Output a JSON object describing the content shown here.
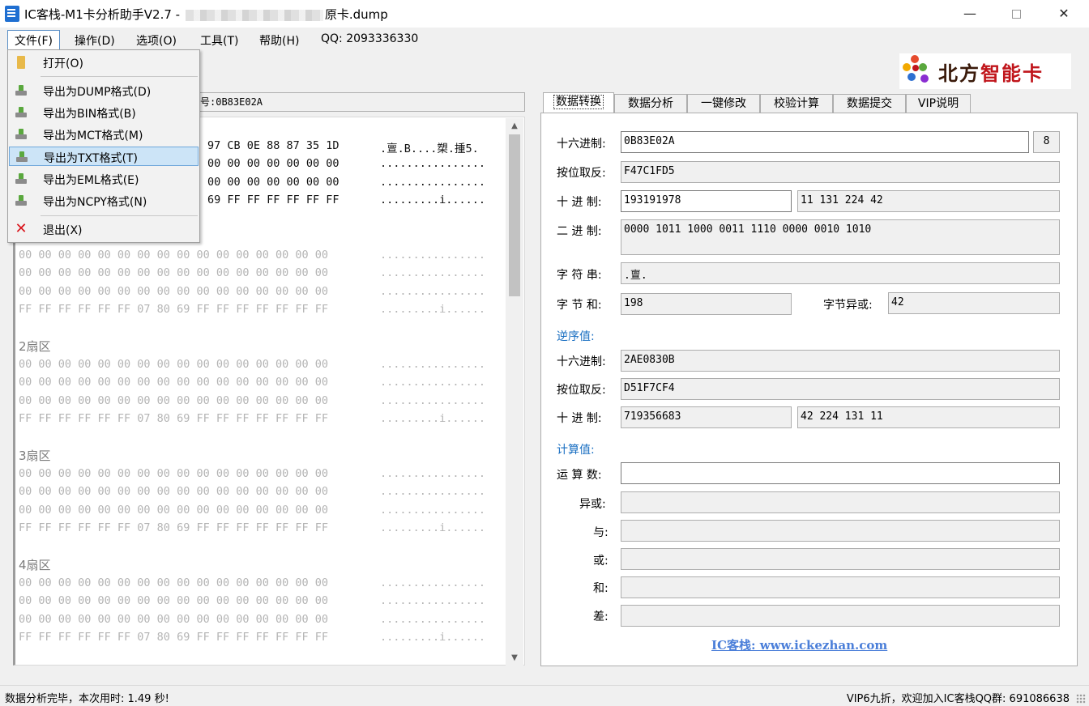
{
  "window": {
    "title_prefix": "IC客栈-M1卡分析助手V2.7 -",
    "title_suffix": "原卡.dump",
    "min": "—",
    "close": "✕"
  },
  "menubar": {
    "file": "文件(F)",
    "operate": "操作(D)",
    "options": "选项(O)",
    "tools": "工具(T)",
    "help": "帮助(H)",
    "qq": "QQ: 2093336330"
  },
  "logo": {
    "text_a": "北方",
    "text_b": "智能卡"
  },
  "file_menu": {
    "open": "打开(O)",
    "dump": "导出为DUMP格式(D)",
    "bin": "导出为BIN格式(B)",
    "mct": "导出为MCT格式(M)",
    "txt": "导出为TXT格式(T)",
    "eml": "导出为EML格式(E)",
    "ncpy": "导出为NCPY格式(N)",
    "exit": "退出(X)"
  },
  "left": {
    "card_no": "卡号:0B83E02A",
    "sector0": [
      {
        "hex": "97 CB 0E 88 87 35 1D",
        "ascii": ".亶.B....槊.揰5."
      },
      {
        "hex": "00 00 00 00 00 00 00",
        "ascii": "................"
      },
      {
        "hex": "00 00 00 00 00 00 00",
        "ascii": "................"
      },
      {
        "hex": "69 FF FF FF FF FF FF",
        "ascii": ".........i......"
      }
    ],
    "sectors": [
      {
        "title": "",
        "rows": [
          {
            "hex": "00 00 00 00 00 00 00 00 00 00 00 00 00 00 00 00",
            "ascii": "................"
          },
          {
            "hex": "00 00 00 00 00 00 00 00 00 00 00 00 00 00 00 00",
            "ascii": "................"
          },
          {
            "hex": "00 00 00 00 00 00 00 00 00 00 00 00 00 00 00 00",
            "ascii": "................"
          },
          {
            "hex": "FF FF FF FF FF FF 07 80 69 FF FF FF FF FF FF FF",
            "ascii": ".........i......"
          }
        ]
      },
      {
        "title": "2扇区",
        "rows": [
          {
            "hex": "00 00 00 00 00 00 00 00 00 00 00 00 00 00 00 00",
            "ascii": "................"
          },
          {
            "hex": "00 00 00 00 00 00 00 00 00 00 00 00 00 00 00 00",
            "ascii": "................"
          },
          {
            "hex": "00 00 00 00 00 00 00 00 00 00 00 00 00 00 00 00",
            "ascii": "................"
          },
          {
            "hex": "FF FF FF FF FF FF 07 80 69 FF FF FF FF FF FF FF",
            "ascii": ".........i......"
          }
        ]
      },
      {
        "title": "3扇区",
        "rows": [
          {
            "hex": "00 00 00 00 00 00 00 00 00 00 00 00 00 00 00 00",
            "ascii": "................"
          },
          {
            "hex": "00 00 00 00 00 00 00 00 00 00 00 00 00 00 00 00",
            "ascii": "................"
          },
          {
            "hex": "00 00 00 00 00 00 00 00 00 00 00 00 00 00 00 00",
            "ascii": "................"
          },
          {
            "hex": "FF FF FF FF FF FF 07 80 69 FF FF FF FF FF FF FF",
            "ascii": ".........i......"
          }
        ]
      },
      {
        "title": "4扇区",
        "rows": [
          {
            "hex": "00 00 00 00 00 00 00 00 00 00 00 00 00 00 00 00",
            "ascii": "................"
          },
          {
            "hex": "00 00 00 00 00 00 00 00 00 00 00 00 00 00 00 00",
            "ascii": "................"
          },
          {
            "hex": "00 00 00 00 00 00 00 00 00 00 00 00 00 00 00 00",
            "ascii": "................"
          },
          {
            "hex": "FF FF FF FF FF FF 07 80 69 FF FF FF FF FF FF FF",
            "ascii": ".........i......"
          }
        ]
      }
    ]
  },
  "tabs": [
    "数据转换",
    "数据分析",
    "一键修改",
    "校验计算",
    "数据提交",
    "VIP说明"
  ],
  "convert": {
    "hex_label": "十六进制:",
    "hex_value": "0B83E02A",
    "hex_len": "8",
    "invert_label": "按位取反:",
    "invert_value": "F47C1FD5",
    "dec_label": "十 进 制:",
    "dec_value": "193191978",
    "dec_bytes": "11 131 224 42",
    "bin_label": "二 进 制:",
    "bin_value": "0000 1011 1000 0011 1110 0000 0010 1010",
    "str_label": "字 符 串:",
    "str_value": ".亶.",
    "sum_label": "字 节 和:",
    "sum_value": "198",
    "xor_label": "字节异或:",
    "xor_value": "42",
    "rev_title": "逆序值:",
    "rev_hex_label": "十六进制:",
    "rev_hex_value": "2AE0830B",
    "rev_invert_label": "按位取反:",
    "rev_invert_value": "D51F7CF4",
    "rev_dec_label": "十 进 制:",
    "rev_dec_value": "719356683",
    "rev_dec_bytes": "42 224 131 11",
    "calc_title": "计算值:",
    "operand_label": "运 算 数:",
    "xor2_label": "异或:",
    "and_label": "与:",
    "or_label": "或:",
    "add_label": "和:",
    "sub_label": "差:",
    "link": "IC客栈: www.ickezhan.com"
  },
  "status": {
    "left": "数据分析完毕，本次用时: 1.49 秒!",
    "right": "VIP6九折，欢迎加入IC客栈QQ群: 691086638"
  }
}
